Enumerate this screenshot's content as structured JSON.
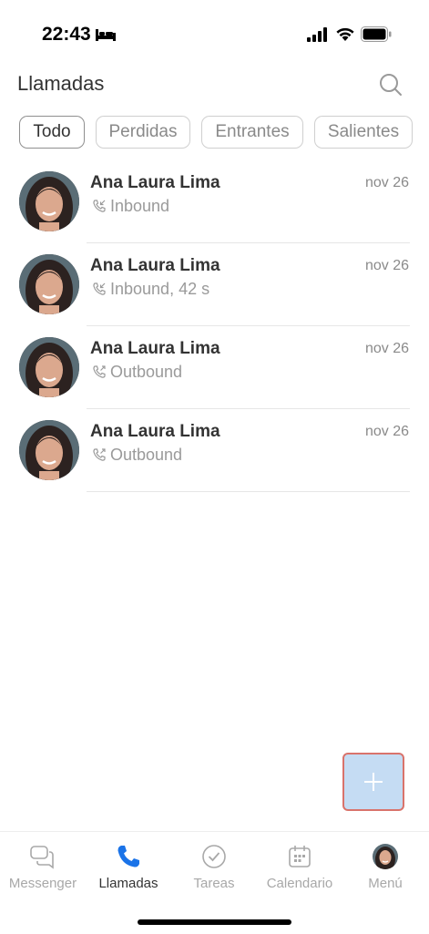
{
  "status_bar": {
    "time": "22:43",
    "icons": [
      "bed-icon",
      "signal-icon",
      "wifi-icon",
      "battery-icon"
    ]
  },
  "header": {
    "title": "Llamadas",
    "search_icon": "search-icon"
  },
  "filters": [
    {
      "label": "Todo",
      "active": true
    },
    {
      "label": "Perdidas",
      "active": false
    },
    {
      "label": "Entrantes",
      "active": false
    },
    {
      "label": "Salientes",
      "active": false
    }
  ],
  "calls": [
    {
      "name": "Ana Laura Lima",
      "date": "nov 26",
      "direction_icon": "incoming-call-icon",
      "detail": "Inbound"
    },
    {
      "name": "Ana Laura Lima",
      "date": "nov 26",
      "direction_icon": "incoming-call-icon",
      "detail": "Inbound, 42 s"
    },
    {
      "name": "Ana Laura Lima",
      "date": "nov 26",
      "direction_icon": "outgoing-call-icon",
      "detail": "Outbound"
    },
    {
      "name": "Ana Laura Lima",
      "date": "nov 26",
      "direction_icon": "outgoing-call-icon",
      "detail": "Outbound"
    }
  ],
  "fab": {
    "icon": "plus-icon"
  },
  "tabs": [
    {
      "label": "Messenger",
      "icon": "chat-bubbles-icon",
      "active": false
    },
    {
      "label": "Llamadas",
      "icon": "phone-icon",
      "active": true
    },
    {
      "label": "Tareas",
      "icon": "check-circle-icon",
      "active": false
    },
    {
      "label": "Calendario",
      "icon": "calendar-icon",
      "active": false
    },
    {
      "label": "Menú",
      "icon": "avatar-icon",
      "active": false
    }
  ],
  "colors": {
    "accent": "#1a73e8",
    "fab_bg": "#c5dcf3",
    "fab_border": "#d9736b",
    "muted": "#9a9a9a"
  }
}
